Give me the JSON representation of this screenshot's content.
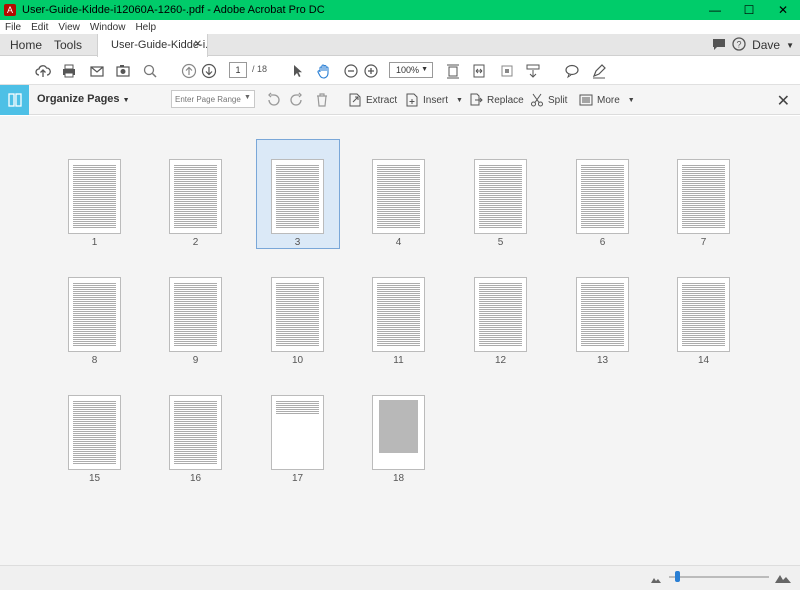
{
  "window": {
    "title": "User-Guide-Kidde-i12060A-1260-.pdf - Adobe Acrobat Pro DC"
  },
  "menu": [
    "File",
    "Edit",
    "View",
    "Window",
    "Help"
  ],
  "tabs": {
    "home": "Home",
    "tools": "Tools",
    "document": "User-Guide-Kidde-i..."
  },
  "user": {
    "name": "Dave"
  },
  "toolbar": {
    "current_page": "1",
    "total_pages": "/ 18",
    "zoom": "100%"
  },
  "organize": {
    "title": "Organize Pages",
    "range_placeholder": "Enter Page Range",
    "extract": "Extract",
    "insert": "Insert",
    "replace": "Replace",
    "split": "Split",
    "more": "More"
  },
  "pages": [
    "1",
    "2",
    "3",
    "4",
    "5",
    "6",
    "7",
    "8",
    "9",
    "10",
    "11",
    "12",
    "13",
    "14",
    "15",
    "16",
    "17",
    "18"
  ],
  "selected_page": "3",
  "zoom_slider_fraction": 0.08
}
